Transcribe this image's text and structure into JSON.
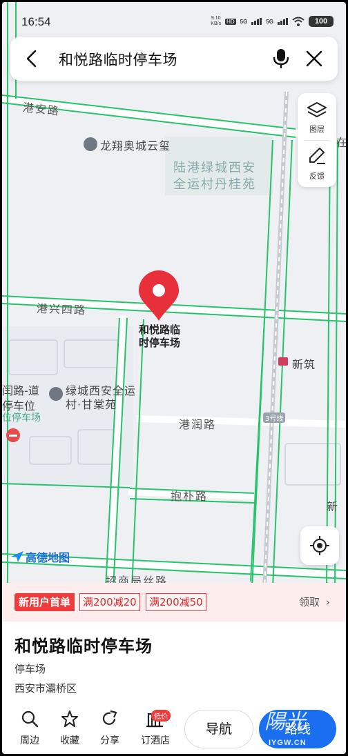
{
  "status_bar": {
    "time": "16:54",
    "net_speed_top": "9.10",
    "net_speed_bottom": "KB/s",
    "hd_label": "HD",
    "network_1": "5G",
    "network_2": "5G",
    "battery": "100"
  },
  "search": {
    "query": "和悦路临时停车场"
  },
  "map": {
    "labels": {
      "gang_an_road": "港安路",
      "longxiang": "龙翔奥城云玺",
      "lugang_1": "陆港绿城西安",
      "lugang_2": "全运村丹桂苑",
      "gangxing4": "港兴四路",
      "xinzhu": "新筑",
      "lvcheng_1": "绿城西安全运",
      "lvcheng_2": "村·甘棠苑",
      "left_1": "闰路-道",
      "left_2": "停车位",
      "left_3": "位停车场",
      "gangrun": "港润路",
      "line3": "3号线",
      "baopu": "抱朴路",
      "zhaoshang": "招商局丝路",
      "right_edge_1": "新",
      "right_edge_2": "在"
    },
    "pin": {
      "label_line1": "和悦路临",
      "label_line2": "时停车场"
    },
    "tools": {
      "layers_label": "图层",
      "feedback_label": "反馈"
    },
    "logo": "高德地图"
  },
  "coupon": {
    "new_user": "新用户首单",
    "offer_a": "满200减20",
    "offer_b": "满200减50",
    "claim": "领取"
  },
  "place": {
    "title": "和悦路临时停车场",
    "category": "停车场",
    "address": "西安市灞桥区"
  },
  "actions": {
    "nearby": "周边",
    "favorite": "收藏",
    "share": "分享",
    "hotel": "订酒店",
    "hotel_badge": "低价",
    "navigate": "导航",
    "route": "路线"
  },
  "watermark": {
    "text": "陽光",
    "site": "IYGW.CN"
  },
  "colors": {
    "road_green": "#27c36b",
    "pin_red": "#e8303a",
    "accent_blue": "#1a6ff0",
    "coupon_red": "#ef3b3b"
  }
}
